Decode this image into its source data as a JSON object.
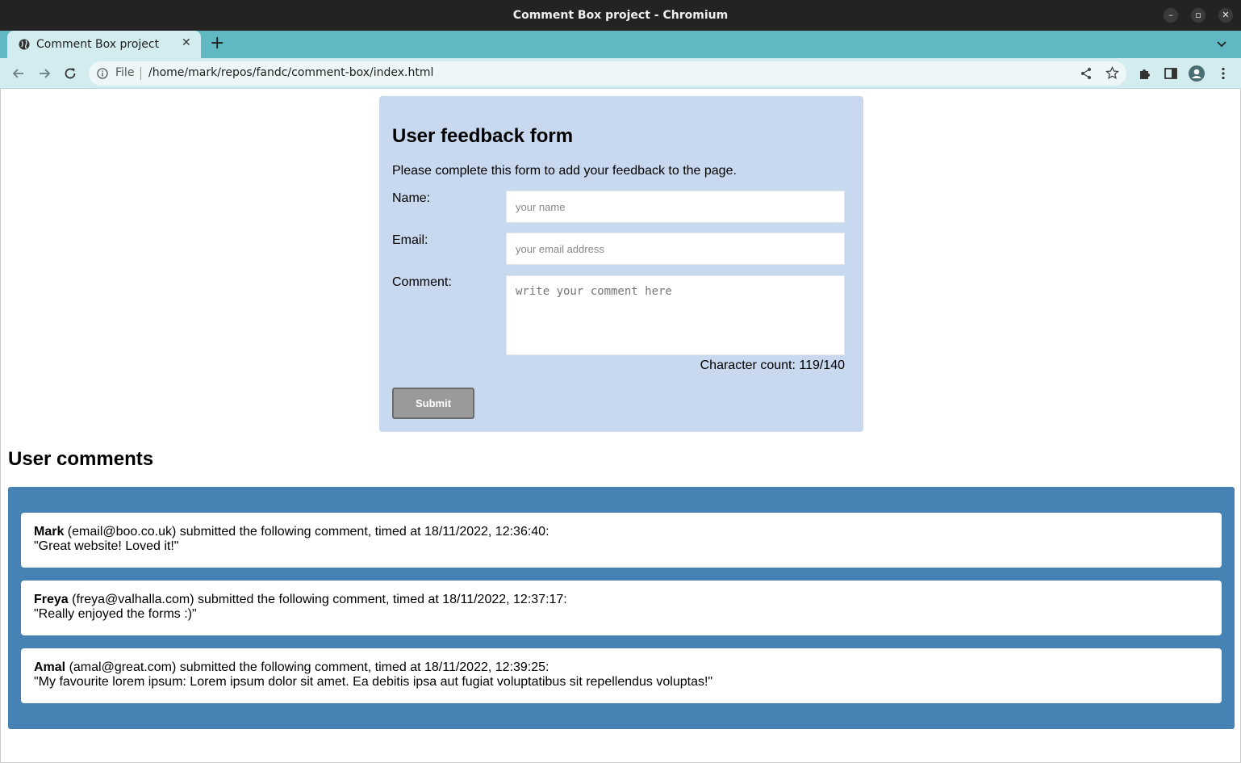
{
  "window": {
    "title": "Comment Box project - Chromium"
  },
  "tab": {
    "title": "Comment Box project",
    "close": "✕",
    "new_tab": "+"
  },
  "omnibox": {
    "scheme_label": "File",
    "url": "/home/mark/repos/fandc/comment-box/index.html"
  },
  "form": {
    "title": "User feedback form",
    "description": "Please complete this form to add your feedback to the page.",
    "name_label": "Name:",
    "name_placeholder": "your name",
    "email_label": "Email:",
    "email_placeholder": "your email address",
    "comment_label": "Comment:",
    "comment_placeholder": "write your comment here",
    "char_count": "Character count: 119/140",
    "submit_label": "Submit"
  },
  "comments": {
    "heading": "User comments",
    "items": [
      {
        "name": "Mark",
        "meta": " (email@boo.co.uk) submitted the following comment, timed at 18/11/2022, 12:36:40:",
        "text": "\"Great website! Loved it!\""
      },
      {
        "name": "Freya",
        "meta": " (freya@valhalla.com) submitted the following comment, timed at 18/11/2022, 12:37:17:",
        "text": "\"Really enjoyed the forms :)\""
      },
      {
        "name": "Amal",
        "meta": " (amal@great.com) submitted the following comment, timed at 18/11/2022, 12:39:25:",
        "text": "\"My favourite lorem ipsum: Lorem ipsum dolor sit amet. Ea debitis ipsa aut fugiat voluptatibus sit repellendus voluptas!\""
      }
    ]
  },
  "colors": {
    "tabstrip": "#5fb8c2",
    "toolbar": "#d3ecef",
    "form_bg": "#c8d8ee",
    "comments_bg": "#4682b4"
  }
}
